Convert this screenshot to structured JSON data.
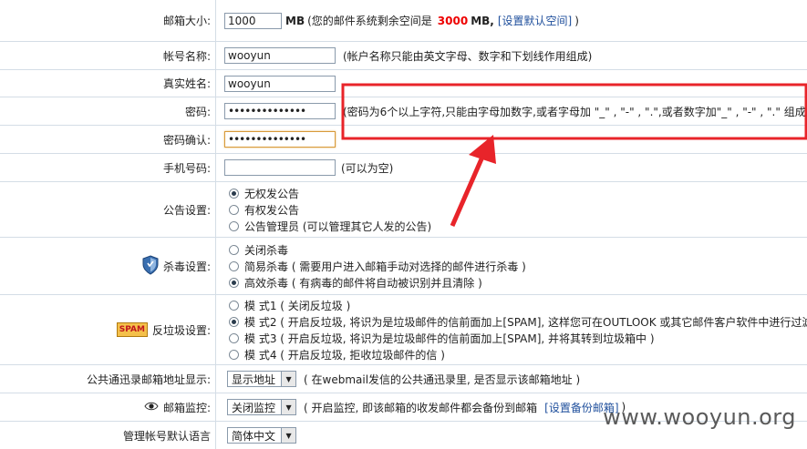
{
  "mailbox_size": {
    "label": "邮箱大小:",
    "value": "1000",
    "unit": "MB",
    "note_prefix": "(您的邮件系统剩余空间是",
    "remaining": "3000",
    "remaining_unit": "MB,",
    "link": "[设置默认空间]",
    "note_suffix": ")"
  },
  "account_name": {
    "label": "帐号名称:",
    "value": "wooyun",
    "note": "(帐户名称只能由英文字母、数字和下划线作用组成)"
  },
  "real_name": {
    "label": "真实姓名:",
    "value": "wooyun"
  },
  "password": {
    "label": "密码:",
    "value": "••••••••••••••",
    "note": "(密码为6个以上字符,只能由字母加数字,或者字母加 \"_\" , \"-\" , \".\",或者数字加\"_\" , \"-\" , \".\" 组成"
  },
  "password_confirm": {
    "label": "密码确认:",
    "value": "••••••••••••••"
  },
  "mobile": {
    "label": "手机号码:",
    "value": "",
    "note": "(可以为空)"
  },
  "notice": {
    "label": "公告设置:",
    "options": [
      "无权发公告",
      "有权发公告",
      "公告管理员 (可以管理其它人发的公告)"
    ],
    "selected": 0
  },
  "antivirus": {
    "label": "杀毒设置:",
    "icon": "shield-icon",
    "options": [
      "关闭杀毒",
      "简易杀毒 ( 需要用户进入邮箱手动对选择的邮件进行杀毒 )",
      "高效杀毒 ( 有病毒的邮件将自动被识别并且清除 )"
    ],
    "selected": 2
  },
  "antispam": {
    "label": "反垃圾设置:",
    "icon_text": "SPAM",
    "options": [
      "模 式1 ( 关闭反垃圾 )",
      "模 式2 ( 开启反垃圾, 将识为是垃圾邮件的信前面加上[SPAM], 这样您可在OUTLOOK 或其它邮件客户软件中进行过滤",
      "模 式3 ( 开启反垃圾, 将识为是垃圾邮件的信前面加上[SPAM], 并将其转到垃圾箱中 )",
      "模 式4 ( 开启反垃圾, 拒收垃圾邮件的信 )"
    ],
    "selected": 1
  },
  "address_book": {
    "label": "公共通迅录邮箱地址显示:",
    "select": "显示地址",
    "note": "( 在webmail发信的公共通迅录里, 是否显示该邮箱地址 )"
  },
  "monitor": {
    "label": "邮箱监控:",
    "icon": "eye-icon",
    "select": "关闭监控",
    "note": "( 开启监控, 即该邮箱的收发邮件都会备份到邮箱",
    "link": "[设置备份邮箱]",
    "note_suffix": ")"
  },
  "language": {
    "label": "管理帐号默认语言",
    "select": "简体中文"
  },
  "watermark": "www.wooyun.org",
  "colors": {
    "highlight": "#e8242a",
    "border": "#d4dde6",
    "link": "#1f4f9c"
  }
}
